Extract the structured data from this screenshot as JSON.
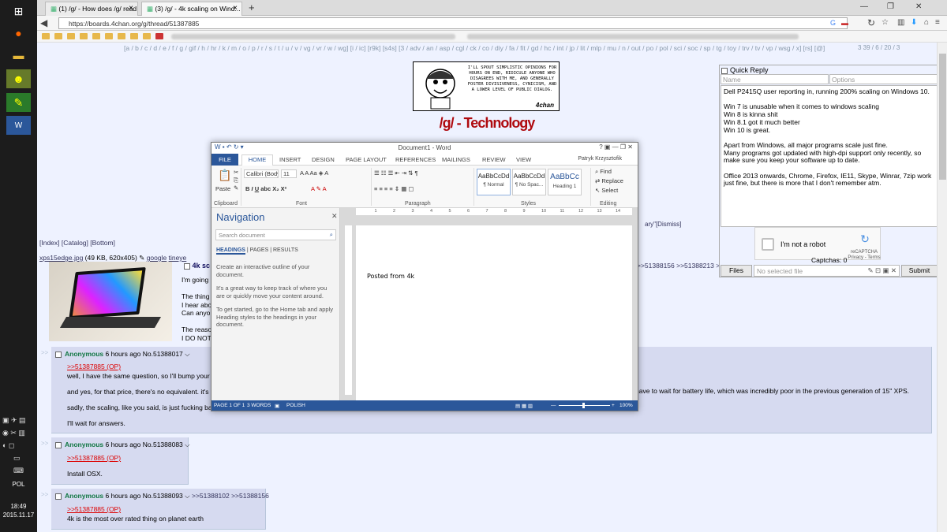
{
  "browser": {
    "tabs": [
      {
        "title": "(1) /g/ - How does /g/ read ..."
      },
      {
        "title": "(3) /g/ - 4k scaling on Wind..."
      }
    ],
    "url": "https://boards.4chan.org/g/thread/51387885"
  },
  "taskbar": {
    "language": "POL",
    "time": "18:49",
    "date": "2015.11.17"
  },
  "page": {
    "board_list": "[a / b / c / d / e / f / g / gif / h / hr / k / m / o / p / r / s / t / u / v / vg / vr / w / wg] [i / ic] [r9k] [s4s] [3 / adv / an / asp / cgl / ck / co / diy / fa / fit / gd / hc / int / jp / lit / mlp / mu / n / out / po / pol / sci / soc / sp / tg / toy / trv / tv / vp / wsg / x] [rs] [@]",
    "board_list_right": "3 39 / 6 / 20 / 3",
    "banner_text": "I'll spout simplistic opinions for hours on end, ridicule anyone who disagrees with me, and generally foster divisiveness, cynicism, and a lower level of public dialog.",
    "banner_sig": "4chan",
    "board_title": "/g/ - Technology",
    "top_nav": "[Index] [Catalog] [Bottom]",
    "dismiss": "ary\"[Dismiss]",
    "file_name": "xps15edge.jpg",
    "file_info": " (49 KB, 620x405) ",
    "file_google": "google",
    "file_tineye": "tineye",
    "op_subject": "4k sc",
    "op_lines": [
      "I'm going",
      "",
      "The thing",
      "I hear abo",
      "Can anyo",
      "",
      "The reaso",
      "I DO NOT"
    ],
    "op_backlinks": ">>51388156 >>51388213 >>513"
  },
  "replies": [
    {
      "header": "Anonymous",
      "meta": " 6 hours ago No.51388017 ",
      "quote": ">>51387885 (OP)",
      "lines": [
        "well, I have the same question, so I'll bump your",
        "and yes, for that price, there's no equivalent. it's",
        "sadly, the scaling, like you said, is just fucking ba",
        "I'll wait for answers."
      ],
      "tail": "have to wait for battery life, which was incredibly poor in the previous generation of 15\" XPS."
    },
    {
      "header": "Anonymous",
      "meta": " 6 hours ago No.51388083 ",
      "quote": ">>51387885 (OP)",
      "lines": [
        "Install OSX."
      ]
    },
    {
      "header": "Anonymous",
      "meta": " 6 hours ago No.51388093 ",
      "backlinks": ">>51388102 >>51388156",
      "quote": ">>51387885 (OP)",
      "lines": [
        "4k is the most over rated thing on planet earth"
      ]
    }
  ],
  "quick_reply": {
    "title": "Quick Reply",
    "name_placeholder": "Name",
    "options_placeholder": "Options",
    "comment": "Dell P2415Q user reporting in, running 200% scaling on Windows 10.\n\nWin 7 is unusable when it comes to windows scaling\nWin 8 is kinna shit\nWin 8.1 got it much better\nWin 10 is great.\n\nApart from Windows, all major programs scale just fine.\nMany programs got updated with high-dpi support only recently, so make sure you keep your software up to date.\n\nOffice 2013 onwards, Chrome, Firefox, IE11, Skype, Winrar, 7zip work just fine, but there is more that I don't remember atm.",
    "captcha_label": "I'm not a robot",
    "captcha_brand": "reCAPTCHA",
    "captcha_terms": "Privacy - Terms",
    "captcha_count": "Captchas: 0",
    "files_label": "Files",
    "file_placeholder": "No selected file",
    "submit_label": "Submit"
  },
  "word": {
    "title": "Document1 - Word",
    "tabs": [
      "FILE",
      "HOME",
      "INSERT",
      "DESIGN",
      "PAGE LAYOUT",
      "REFERENCES",
      "MAILINGS",
      "REVIEW",
      "VIEW"
    ],
    "user": "Patryk Krzysztofik",
    "font_name": "Calibri (Body",
    "font_size": "11",
    "paste": "Paste",
    "groups": {
      "clipboard": "Clipboard",
      "font": "Font",
      "paragraph": "Paragraph",
      "styles": "Styles",
      "editing": "Editing"
    },
    "styles": [
      {
        "sample": "AaBbCcDd",
        "name": "¶ Normal"
      },
      {
        "sample": "AaBbCcDd",
        "name": "¶ No Spac..."
      },
      {
        "sample": "AaBbCc",
        "name": "Heading 1"
      }
    ],
    "editing": [
      "Find",
      "Replace",
      "Select"
    ],
    "nav_title": "Navigation",
    "nav_search_placeholder": "Search document",
    "nav_tabs": [
      "HEADINGS",
      "PAGES",
      "RESULTS"
    ],
    "nav_help": [
      "Create an interactive outline of your document.",
      "It's a great way to keep track of where you are or quickly move your content around.",
      "To get started, go to the Home tab and apply Heading styles to the headings in your document."
    ],
    "doc_text": "Posted from 4k",
    "status": {
      "page": "PAGE 1 OF 1",
      "words": "3 WORDS",
      "lang": "POLISH",
      "zoom": "100%"
    }
  },
  "colors": {
    "word_accent": "#2b579a",
    "board_title": "#af0a0f",
    "name_green": "#117743",
    "quote_red": "#dd0000"
  }
}
